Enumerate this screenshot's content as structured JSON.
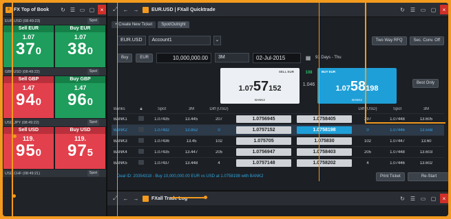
{
  "left_panel": {
    "title": "FX Top of Book",
    "pairs": [
      {
        "name": "EUR.USD",
        "time": "(08:49:23)",
        "spot": "Spot",
        "sell": {
          "label": "Sell EUR",
          "big": "1.07",
          "pips": "37",
          "frac": "0"
        },
        "buy": {
          "label": "Buy EUR",
          "big": "1.07",
          "pips": "38",
          "frac": "0"
        }
      },
      {
        "name": "GBP.USD",
        "time": "(08:49:22)",
        "spot": "Spot",
        "sell": {
          "label": "Sell GBP",
          "big": "1.47",
          "pips": "94",
          "frac": "0"
        },
        "buy": {
          "label": "Buy GBP",
          "big": "1.47",
          "pips": "96",
          "frac": "0"
        }
      },
      {
        "name": "USD.JPY",
        "time": "(08:49:22)",
        "spot": "Spot",
        "sell": {
          "label": "Sell USD",
          "big": "119.",
          "pips": "95",
          "frac": "0"
        },
        "buy": {
          "label": "Buy USD",
          "big": "119.",
          "pips": "97",
          "frac": "5"
        }
      },
      {
        "name": "USD.CHF",
        "time": "(08:49:21)",
        "spot": "Spot"
      }
    ]
  },
  "quicktrade": {
    "title": "EUR.USD | FXall Quicktrade",
    "tabs": [
      "+ Create New Ticket",
      "Spot/Outright"
    ],
    "pair": "EUR.USD",
    "account": "Account1",
    "two_way": "Two Way RFQ",
    "sec_conv": "Sec. Conv. Off",
    "side": "Buy",
    "ccy": "EUR",
    "amount": "10,000,000.00",
    "tenor": "3M",
    "date": "02-Jul-2015",
    "days": "91 Days - Thu",
    "sell_box": {
      "label": "SELL EUR",
      "big": "1.07",
      "pips": "57",
      "frac": "152",
      "bank": "BANK2"
    },
    "buy_box": {
      "label": "BUY EUR",
      "big": "1.07",
      "pips": "58",
      "frac": "198",
      "bank": "BANK2"
    },
    "spread_top": "108",
    "spread": "1.046",
    "best_only": "Best Only",
    "headers": {
      "banks": "Banks",
      "spot": "Spot",
      "pips": "3M",
      "diff": "Diff (USD)",
      "diff2": "Diff (USD)",
      "spot2": "Spot",
      "pips2": "3M"
    },
    "rows": [
      {
        "bank": "BANK1",
        "spot": "1.07435",
        "pips": "13.445",
        "diff": "207",
        "sell": "1.0756945",
        "buy": "1.0758405",
        "diff2": "297",
        "spot2": "1.07448",
        "pips2": "13.605",
        "hl": false
      },
      {
        "bank": "BANK2",
        "spot": "1.07432",
        "pips": "13.852",
        "diff": "0",
        "sell": "1.0757152",
        "buy": "1.0758198",
        "diff2": "0",
        "spot2": "1.07446",
        "pips2": "13.558",
        "hl": true
      },
      {
        "bank": "BANK3",
        "spot": "1.07436",
        "pips": "13.45",
        "diff": "102",
        "sell": "1.075705",
        "buy": "1.075830",
        "diff2": "102",
        "spot2": "1.07447",
        "pips2": "13.60",
        "hl": false
      },
      {
        "bank": "BANK4",
        "spot": "1.07435",
        "pips": "13.447",
        "diff": "205",
        "sell": "1.0756947",
        "buy": "1.0758403",
        "diff2": "205",
        "spot2": "1.07448",
        "pips2": "13.603",
        "hl": false
      },
      {
        "bank": "BANK5",
        "spot": "1.07437",
        "pips": "13.448",
        "diff": "4",
        "sell": "1.0757148",
        "buy": "1.0758202",
        "diff2": "4",
        "spot2": "1.07446",
        "pips2": "13.602",
        "hl": false
      }
    ],
    "deal_text": "Deal ID: 20354318 - Buy 10,000,000.00 EUR vs USD at 1.0758198 with BANK2",
    "print_ticket": "Print Ticket",
    "restart": "Re-Start"
  },
  "trade_log": {
    "title": "FXall Trade Log"
  },
  "colors": {
    "accent": "#f39a1f",
    "green": "#1e9d5c",
    "red": "#e2404c",
    "blue": "#1f9fd8"
  }
}
